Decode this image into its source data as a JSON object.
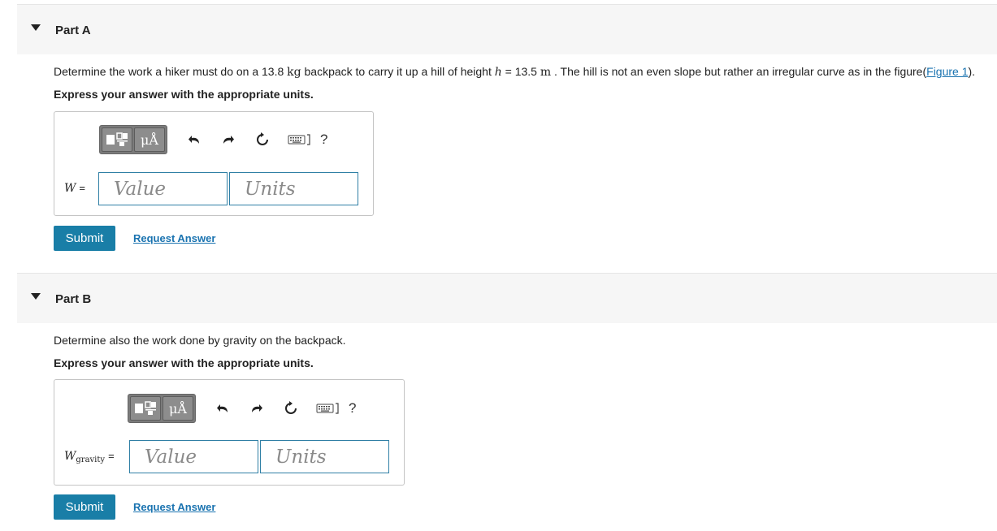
{
  "colors": {
    "accent": "#197ea7",
    "link": "#1a73b0",
    "header_bg": "#f6f6f6",
    "field_border": "#2f7fa5"
  },
  "toolbar": {
    "units_label": "μÅ",
    "help_label": "?",
    "icons": [
      "templates-icon",
      "units-icon",
      "undo-icon",
      "redo-icon",
      "reset-icon",
      "keyboard-icon",
      "help-icon"
    ]
  },
  "partA": {
    "title": "Part A",
    "question_pre": "Determine the work a hiker must do on a 13.8 ",
    "mass_unit": "kg",
    "question_mid": " backpack to carry it up a hill of height ",
    "height_var": "h",
    "height_eq": " = 13.5 ",
    "height_unit": "m",
    "question_post": " . The hill is not an even slope but rather an irregular curve as in the figure(",
    "figure_link": "Figure 1",
    "question_end": ").",
    "instruction": "Express your answer with the appropriate units.",
    "var_name": "W",
    "equals": "=",
    "value_placeholder": "Value",
    "units_placeholder": "Units",
    "submit_label": "Submit",
    "request_label": "Request Answer"
  },
  "partB": {
    "title": "Part B",
    "question": "Determine also the work done by gravity on the backpack.",
    "instruction": "Express your answer with the appropriate units.",
    "var_name": "W",
    "var_sub": "gravity",
    "equals": "=",
    "value_placeholder": "Value",
    "units_placeholder": "Units",
    "submit_label": "Submit",
    "request_label": "Request Answer"
  }
}
